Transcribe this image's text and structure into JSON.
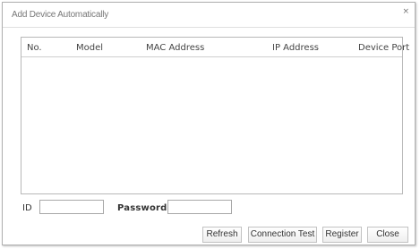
{
  "dialog": {
    "title": "Add Device Automatically",
    "close_glyph": "×"
  },
  "table": {
    "columns": {
      "no": "No.",
      "model": "Model",
      "mac": "MAC Address",
      "ip": "IP Address",
      "port": "Device Port"
    },
    "rows": []
  },
  "credentials": {
    "id_label": "ID",
    "id_value": "",
    "password_label": "Password",
    "password_value": ""
  },
  "buttons": {
    "refresh": "Refresh",
    "connection_test": "Connection Test",
    "register": "Register",
    "close": "Close"
  }
}
